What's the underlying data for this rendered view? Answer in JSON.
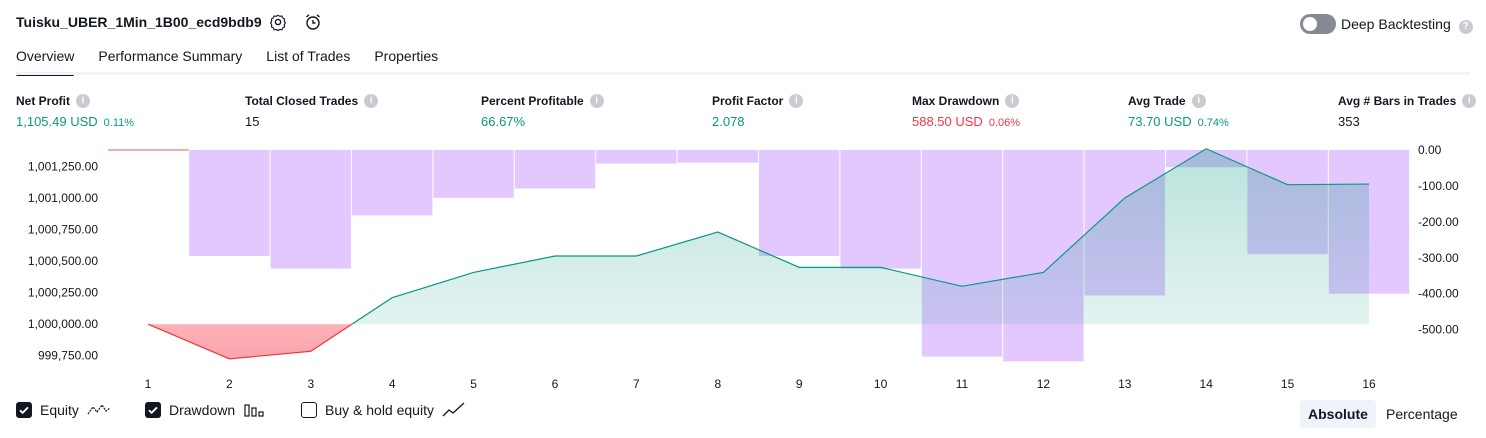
{
  "header": {
    "title": "Tuisku_UBER_1Min_1B00_ecd9bdb9",
    "settings_icon": "gear-icon",
    "alert_icon": "alarm-clock-plus-icon",
    "deep_backtesting_label": "Deep Backtesting",
    "deep_backtesting_on": false
  },
  "tabs": [
    {
      "label": "Overview",
      "active": true
    },
    {
      "label": "Performance Summary",
      "active": false
    },
    {
      "label": "List of Trades",
      "active": false
    },
    {
      "label": "Properties",
      "active": false
    }
  ],
  "stats": [
    {
      "label": "Net Profit",
      "value": "1,105.49 USD",
      "pct": "0.11%",
      "color": "#089981"
    },
    {
      "label": "Total Closed Trades",
      "value": "15",
      "pct": "",
      "color": "#131722"
    },
    {
      "label": "Percent Profitable",
      "value": "66.67%",
      "pct": "",
      "color": "#089981"
    },
    {
      "label": "Profit Factor",
      "value": "2.078",
      "pct": "",
      "color": "#089981"
    },
    {
      "label": "Max Drawdown",
      "value": "588.50 USD",
      "pct": "0.06%",
      "color": "#f23645"
    },
    {
      "label": "Avg Trade",
      "value": "73.70 USD",
      "pct": "0.74%",
      "color": "#089981"
    },
    {
      "label": "Avg # Bars in Trades",
      "value": "353",
      "pct": "",
      "color": "#131722"
    }
  ],
  "chart_data": {
    "type": "line",
    "x": [
      1,
      2,
      3,
      4,
      5,
      6,
      7,
      8,
      9,
      10,
      11,
      12,
      13,
      14,
      15,
      16
    ],
    "left_axis_ticks": [
      "1,001,250.00",
      "1,001,000.00",
      "1,000,750.00",
      "1,000,500.00",
      "1,000,250.00",
      "1,000,000.00",
      "999,750.00"
    ],
    "left_ylim": [
      999700,
      1001380
    ],
    "right_axis_ticks": [
      "0.00",
      "-100.00",
      "-200.00",
      "-300.00",
      "-400.00",
      "-500.00"
    ],
    "right_ylim": [
      -590,
      0
    ],
    "series": [
      {
        "name": "Equity",
        "axis": "left",
        "color": "#089981",
        "values": [
          1000000,
          999725,
          999785,
          1000210,
          1000410,
          1000540,
          1000540,
          1000730,
          1000450,
          1000450,
          1000300,
          1000410,
          1001000,
          1001390,
          1001105,
          1001110
        ]
      },
      {
        "name": "Drawdown",
        "axis": "right",
        "type": "bar",
        "color": "#e1c4ff",
        "values": [
          0,
          -295,
          -330,
          -182,
          -133,
          -107,
          -38,
          -35,
          -295,
          -330,
          -575,
          -588,
          -405,
          -48,
          -290,
          -400
        ]
      }
    ],
    "grid": false,
    "legend": "bottom-left"
  },
  "legend": [
    {
      "label": "Equity",
      "checked": true,
      "icon": "equity-line-icon"
    },
    {
      "label": "Drawdown",
      "checked": true,
      "icon": "drawdown-bars-icon"
    },
    {
      "label": "Buy & hold equity",
      "checked": false,
      "icon": "buy-hold-line-icon"
    }
  ],
  "view_toggle": {
    "absolute": "Absolute",
    "percentage": "Percentage",
    "selected": "Absolute"
  }
}
